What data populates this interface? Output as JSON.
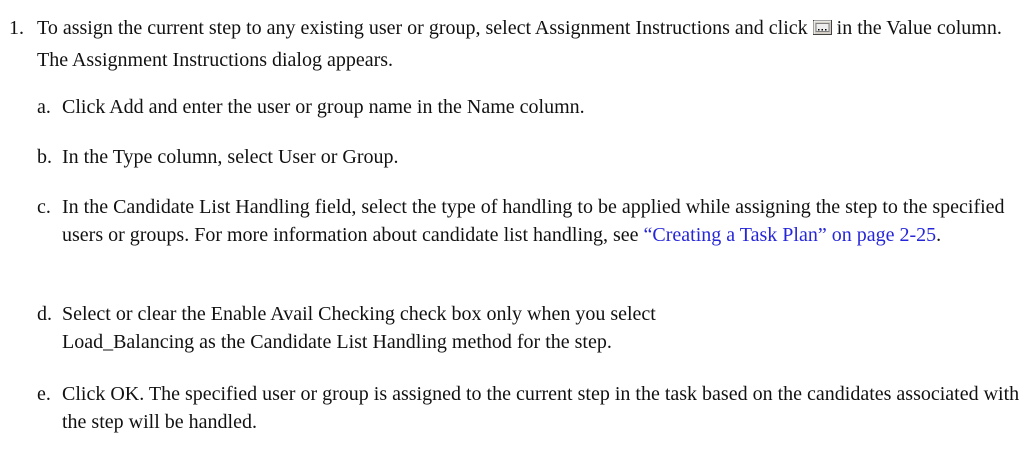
{
  "step": {
    "number": "1.",
    "text_before_icon": "To assign the current step to any existing user or group, select Assignment Instructions and click",
    "icon": "ellipsis-button-icon",
    "text_after_icon": "in the Value column. The Assignment Instructions dialog appears."
  },
  "substeps": [
    {
      "letter": "a.",
      "text": "Click Add and enter the user or group name in the Name column."
    },
    {
      "letter": "b.",
      "text": "In the Type column, select User or Group."
    },
    {
      "letter": "c.",
      "text": "In the Candidate List Handling field, select the type of handling to be applied while assigning the step to the specified users or groups. For more information about candidate list handling, see",
      "link": "“Creating a Task Plan” on page 2-25",
      "text_after_link": "."
    },
    {
      "letter": "d.",
      "text": "Select or clear the Enable Avail Checking check box only when you select Load_Balancing as the Candidate List Handling method for the step."
    },
    {
      "letter": "e.",
      "text": "Click OK. The specified user or group is assigned to the current step in the task based on the candidates associated with the step will be handled."
    }
  ],
  "colors": {
    "text": "#111111",
    "link": "#2626d9"
  }
}
